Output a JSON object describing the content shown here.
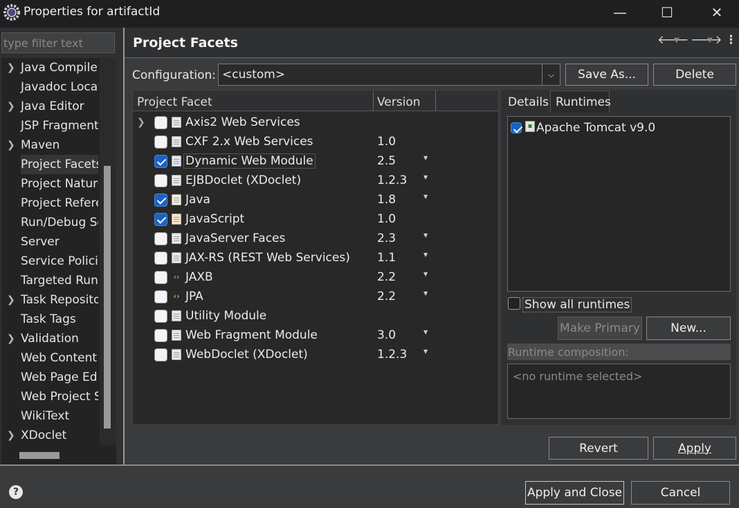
{
  "window": {
    "title": "Properties for artifactId",
    "minimize_glyph": "—",
    "maximize_glyph": "☐",
    "close_glyph": "✕"
  },
  "filter": {
    "placeholder": "type filter text"
  },
  "tree": {
    "items": [
      {
        "label": "Java Compiler",
        "expandable": true
      },
      {
        "label": "Javadoc Location",
        "expandable": false
      },
      {
        "label": "Java Editor",
        "expandable": true
      },
      {
        "label": "JSP Fragment",
        "expandable": false
      },
      {
        "label": "Maven",
        "expandable": true
      },
      {
        "label": "Project Facets",
        "expandable": false,
        "selected": true
      },
      {
        "label": "Project Natures",
        "expandable": false
      },
      {
        "label": "Project References",
        "expandable": false
      },
      {
        "label": "Run/Debug Settings",
        "expandable": false
      },
      {
        "label": "Server",
        "expandable": false
      },
      {
        "label": "Service Policies",
        "expandable": false
      },
      {
        "label": "Targeted Runtimes",
        "expandable": false
      },
      {
        "label": "Task Repository",
        "expandable": true
      },
      {
        "label": "Task Tags",
        "expandable": false
      },
      {
        "label": "Validation",
        "expandable": true
      },
      {
        "label": "Web Content Settings",
        "expandable": false
      },
      {
        "label": "Web Page Editor",
        "expandable": false
      },
      {
        "label": "Web Project Settings",
        "expandable": false
      },
      {
        "label": "WikiText",
        "expandable": false
      },
      {
        "label": "XDoclet",
        "expandable": true
      }
    ]
  },
  "page": {
    "title": "Project Facets",
    "back_icon": "back-arrow-icon",
    "forward_icon": "forward-arrow-icon",
    "menu_icon": "view-menu-icon"
  },
  "configuration": {
    "label": "Configuration:",
    "value": "<custom>",
    "save_as_label": "Save As...",
    "delete_label": "Delete"
  },
  "facets": {
    "col_facet": "Project Facet",
    "col_version": "Version",
    "rows": [
      {
        "name": "Axis2 Web Services",
        "version": "",
        "checked": false,
        "icon": "doc",
        "expandable": true,
        "dropdown": false
      },
      {
        "name": "CXF 2.x Web Services",
        "version": "1.0",
        "checked": false,
        "icon": "doc",
        "dropdown": false
      },
      {
        "name": "Dynamic Web Module",
        "version": "2.5",
        "checked": true,
        "icon": "web",
        "dropdown": true
      },
      {
        "name": "EJBDoclet (XDoclet)",
        "version": "1.2.3",
        "checked": false,
        "icon": "doc",
        "dropdown": true
      },
      {
        "name": "Java",
        "version": "1.8",
        "checked": true,
        "icon": "java",
        "dropdown": true
      },
      {
        "name": "JavaScript",
        "version": "1.0",
        "checked": true,
        "icon": "js",
        "dropdown": false
      },
      {
        "name": "JavaServer Faces",
        "version": "2.3",
        "checked": false,
        "icon": "doc",
        "dropdown": true
      },
      {
        "name": "JAX-RS (REST Web Services)",
        "version": "1.1",
        "checked": false,
        "icon": "doc",
        "dropdown": true
      },
      {
        "name": "JAXB",
        "version": "2.2",
        "checked": false,
        "icon": "code-blue",
        "dropdown": true
      },
      {
        "name": "JPA",
        "version": "2.2",
        "checked": false,
        "icon": "code-orange",
        "dropdown": true
      },
      {
        "name": "Utility Module",
        "version": "",
        "checked": false,
        "icon": "doc",
        "dropdown": false
      },
      {
        "name": "Web Fragment Module",
        "version": "3.0",
        "checked": false,
        "icon": "doc",
        "dropdown": true
      },
      {
        "name": "WebDoclet (XDoclet)",
        "version": "1.2.3",
        "checked": false,
        "icon": "doc",
        "dropdown": true
      }
    ]
  },
  "details": {
    "tab_details": "Details",
    "tab_runtimes": "Runtimes",
    "runtime_name": "Apache Tomcat v9.0",
    "runtime_checked": true,
    "show_all_label": "Show all runtimes",
    "make_primary_label": "Make Primary",
    "new_label": "New...",
    "composition_label": "Runtime composition:",
    "composition_placeholder": "<no runtime selected>"
  },
  "footer": {
    "revert_label": "Revert",
    "apply_label": "Apply",
    "apply_close_label": "Apply and Close",
    "cancel_label": "Cancel"
  }
}
